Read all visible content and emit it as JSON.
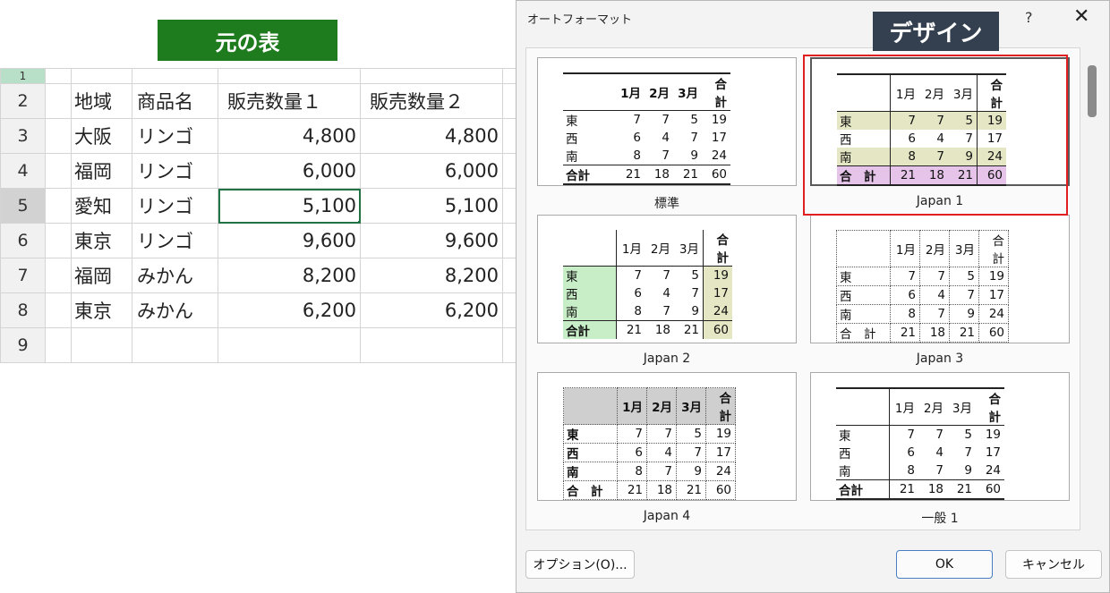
{
  "banner": "元の表",
  "sheet": {
    "row_numbers": [
      "1",
      "2",
      "3",
      "4",
      "5",
      "6",
      "7",
      "8",
      "9"
    ],
    "headers": [
      "地域",
      "商品名",
      "販売数量１",
      "販売数量２"
    ],
    "rows": [
      [
        "大阪",
        "リンゴ",
        "4,800",
        "4,800"
      ],
      [
        "福岡",
        "リンゴ",
        "6,000",
        "6,000"
      ],
      [
        "愛知",
        "リンゴ",
        "5,100",
        "5,100"
      ],
      [
        "東京",
        "リンゴ",
        "9,600",
        "9,600"
      ],
      [
        "福岡",
        "みかん",
        "8,200",
        "8,200"
      ],
      [
        "東京",
        "みかん",
        "6,200",
        "6,200"
      ]
    ],
    "active_row": "5"
  },
  "dialog": {
    "title": "オートフォーマット",
    "help": "?",
    "close": "✕",
    "design_label": "デザイン",
    "cols": [
      "1月",
      "2月",
      "3月",
      "合計"
    ],
    "rows": [
      [
        "東",
        "7",
        "7",
        "5",
        "19"
      ],
      [
        "西",
        "6",
        "4",
        "7",
        "17"
      ],
      [
        "南",
        "8",
        "7",
        "9",
        "24"
      ],
      [
        "合計",
        "21",
        "18",
        "21",
        "60"
      ]
    ],
    "total_spaced": "合　計",
    "formats": [
      "標準",
      "Japan 1",
      "Japan 2",
      "Japan 3",
      "Japan 4",
      "一般 1"
    ],
    "options_button": "オプション(O)...",
    "ok_button": "OK",
    "cancel_button": "キャンセル"
  },
  "colors": {
    "banner": "#1e7b1e",
    "design_badge": "#34404f",
    "highlight": "#e02020",
    "excel_green": "#217346"
  }
}
